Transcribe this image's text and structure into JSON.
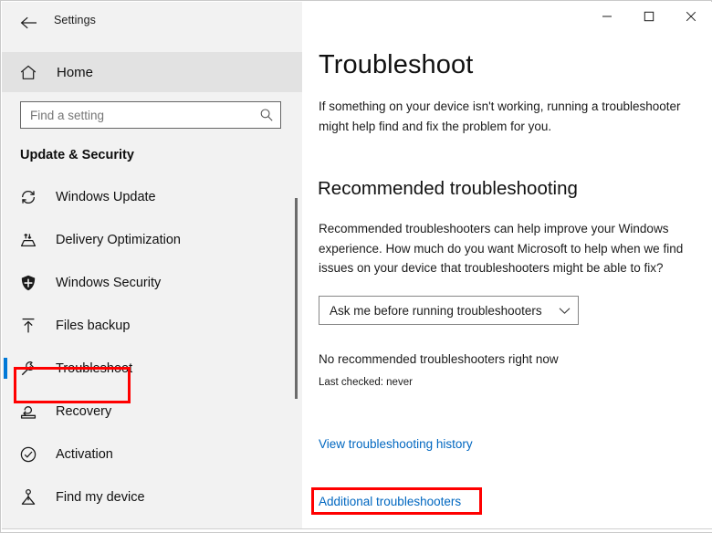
{
  "window": {
    "title": "Settings",
    "back_icon": "back-arrow-icon",
    "controls": {
      "minimize": "minimize-icon",
      "maximize": "maximize-icon",
      "close": "close-icon"
    }
  },
  "sidebar": {
    "home": {
      "label": "Home",
      "icon": "home-icon"
    },
    "search": {
      "value": "",
      "placeholder": "Find a setting",
      "icon": "search-icon"
    },
    "category_heading": "Update & Security",
    "items": [
      {
        "label": "Windows Update",
        "icon": "sync-refresh-icon",
        "selected": false
      },
      {
        "label": "Delivery Optimization",
        "icon": "delivery-optimization-icon",
        "selected": false
      },
      {
        "label": "Windows Security",
        "icon": "shield-icon",
        "selected": false
      },
      {
        "label": "Files backup",
        "icon": "upload-arrow-icon",
        "selected": false
      },
      {
        "label": "Troubleshoot",
        "icon": "wrench-icon",
        "selected": true
      },
      {
        "label": "Recovery",
        "icon": "recovery-icon",
        "selected": false
      },
      {
        "label": "Activation",
        "icon": "check-circle-icon",
        "selected": false
      },
      {
        "label": "Find my device",
        "icon": "find-my-device-icon",
        "selected": false
      }
    ]
  },
  "main": {
    "title": "Troubleshoot",
    "description": "If something on your device isn't working, running a troubleshooter might help find and fix the problem for you.",
    "section": {
      "heading": "Recommended troubleshooting",
      "description": "Recommended troubleshooters can help improve your Windows experience. How much do you want Microsoft to help when we find issues on your device that troubleshooters might be able to fix?",
      "dropdown": {
        "value": "Ask me before running troubleshooters",
        "chevron_icon": "chevron-down-icon",
        "options": [
          "Ask me before running troubleshooters"
        ]
      },
      "status": "No recommended troubleshooters right now",
      "last_checked": "Last checked: never"
    },
    "links": [
      {
        "label": "View troubleshooting history"
      },
      {
        "label": "Additional troubleshooters"
      }
    ]
  },
  "annotations": {
    "highlight_color": "#ff0000",
    "targets": [
      "Troubleshoot",
      "Additional troubleshooters"
    ]
  },
  "colors": {
    "accent": "#0078d7",
    "link": "#0067c0",
    "sidebar_bg": "#f2f2f2",
    "content_bg": "#ffffff",
    "annotation": "#ff0000"
  }
}
